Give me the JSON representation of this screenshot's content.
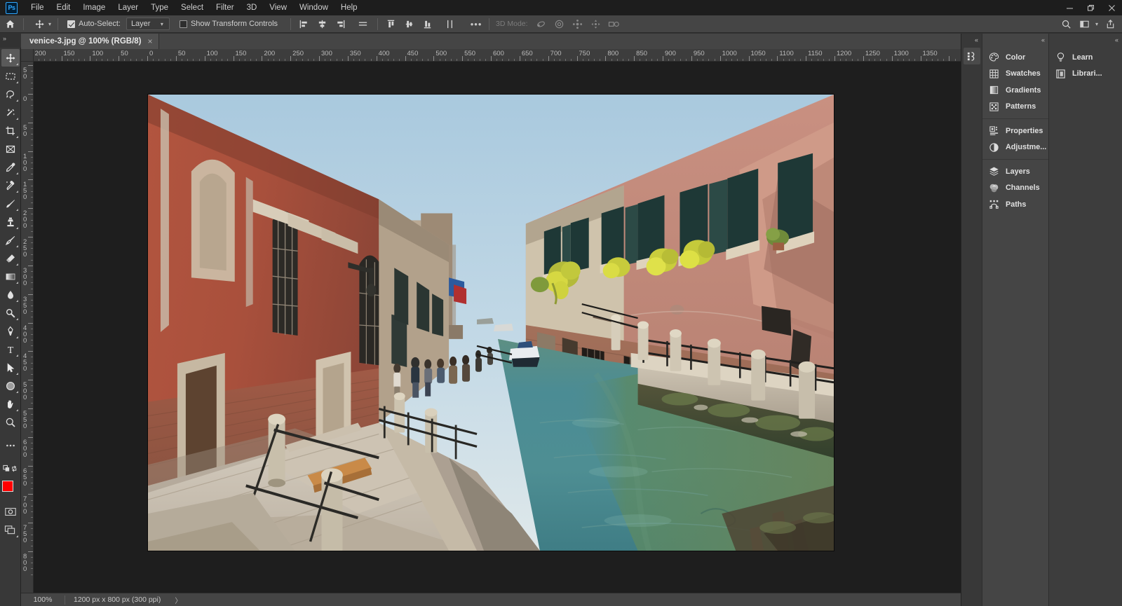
{
  "app": {
    "logo_text": "Ps",
    "title_menus": [
      "File",
      "Edit",
      "Image",
      "Layer",
      "Type",
      "Select",
      "Filter",
      "3D",
      "View",
      "Window",
      "Help"
    ],
    "window_controls": [
      {
        "name": "minimize",
        "glyph": "─"
      },
      {
        "name": "maximize",
        "glyph": "❐"
      },
      {
        "name": "close",
        "glyph": "✕"
      }
    ]
  },
  "options_bar": {
    "home_icon": "home-icon",
    "tool_icon": "move-tool-icon",
    "auto_select_label": "Auto-Select:",
    "auto_select_checked": true,
    "auto_select_scope": "Layer",
    "show_transform_label": "Show Transform Controls",
    "show_transform_checked": false,
    "align_group_1": [
      "align-left-edges",
      "align-horizontal-centers",
      "align-right-edges",
      "align-top-edges"
    ],
    "align_group_2": [
      "distribute-top-edges",
      "distribute-vertical-centers",
      "distribute-bottom-edges",
      "distribute-horizontal"
    ],
    "more_label": "•••",
    "mode_3d_label": "3D Mode:",
    "mode_3d_icons": [
      "rotate-3d-icon",
      "roll-3d-icon",
      "drag-3d-icon",
      "slide-3d-icon",
      "scale-3d-icon"
    ],
    "right_icons": [
      "search-icon",
      "workspace-icon",
      "chevron-down-icon",
      "share-icon"
    ]
  },
  "toolbar": {
    "collapse_glyph": "»",
    "tools": [
      {
        "name": "move-tool",
        "selected": true,
        "more": true
      },
      {
        "name": "rectangular-marquee-tool",
        "selected": false,
        "more": true
      },
      {
        "name": "lasso-tool",
        "selected": false,
        "more": true
      },
      {
        "name": "object-selection-tool",
        "selected": false,
        "more": true
      },
      {
        "name": "crop-tool",
        "selected": false,
        "more": true
      },
      {
        "name": "frame-tool",
        "selected": false,
        "more": false
      },
      {
        "name": "eyedropper-tool",
        "selected": false,
        "more": true
      },
      {
        "name": "spot-healing-brush-tool",
        "selected": false,
        "more": true
      },
      {
        "name": "brush-tool",
        "selected": false,
        "more": true
      },
      {
        "name": "clone-stamp-tool",
        "selected": false,
        "more": true
      },
      {
        "name": "history-brush-tool",
        "selected": false,
        "more": true
      },
      {
        "name": "eraser-tool",
        "selected": false,
        "more": true
      },
      {
        "name": "gradient-tool",
        "selected": false,
        "more": true
      },
      {
        "name": "blur-tool",
        "selected": false,
        "more": true
      },
      {
        "name": "dodge-tool",
        "selected": false,
        "more": true
      },
      {
        "name": "pen-tool",
        "selected": false,
        "more": true
      },
      {
        "name": "horizontal-type-tool",
        "selected": false,
        "more": true
      },
      {
        "name": "path-selection-tool",
        "selected": false,
        "more": true
      },
      {
        "name": "ellipse-tool",
        "selected": false,
        "more": true
      },
      {
        "name": "hand-tool",
        "selected": false,
        "more": true
      },
      {
        "name": "zoom-tool",
        "selected": false,
        "more": false
      },
      {
        "name": "edit-toolbar-tool",
        "selected": false,
        "more": false
      }
    ],
    "quick_mask_name": "quick-mask-mode-button",
    "screen_mode_name": "screen-mode-button",
    "foreground_color": "#ff0000",
    "background_color": "#000000"
  },
  "document": {
    "tab_title": "venice-3.jpg @ 100% (RGB/8)",
    "close_glyph": "×"
  },
  "rulers": {
    "horizontal_labels": [
      "200",
      "150",
      "100",
      "50",
      "0",
      "50",
      "100",
      "150",
      "200",
      "250",
      "300",
      "350",
      "400",
      "450",
      "500",
      "550",
      "600",
      "650",
      "700",
      "750",
      "800",
      "850",
      "900",
      "950",
      "1000",
      "1050",
      "1100",
      "1150",
      "1200",
      "1250",
      "1300",
      "1350"
    ],
    "vertical_labels": [
      "50",
      "0",
      "50",
      "100",
      "150",
      "200",
      "250",
      "300",
      "350",
      "400",
      "450",
      "500",
      "550",
      "600",
      "650",
      "700",
      "750",
      "800"
    ],
    "units": "px"
  },
  "panels": {
    "collapse_glyph": "«",
    "dock_a_icon": "properties-dock-icon",
    "dock_b_groups": [
      [
        {
          "label": "Color",
          "icon": "color-palette-icon"
        },
        {
          "label": "Swatches",
          "icon": "swatches-grid-icon"
        },
        {
          "label": "Gradients",
          "icon": "gradients-icon"
        },
        {
          "label": "Patterns",
          "icon": "patterns-icon"
        }
      ],
      [
        {
          "label": "Properties",
          "icon": "properties-icon"
        },
        {
          "label": "Adjustme...",
          "icon": "adjustments-icon"
        }
      ],
      [
        {
          "label": "Layers",
          "icon": "layers-icon"
        },
        {
          "label": "Channels",
          "icon": "channels-icon"
        },
        {
          "label": "Paths",
          "icon": "paths-icon"
        }
      ]
    ],
    "dock_c_items": [
      {
        "label": "Learn",
        "icon": "lightbulb-icon"
      },
      {
        "label": "Librari...",
        "icon": "libraries-icon"
      }
    ]
  },
  "status_bar": {
    "zoom": "100%",
    "doc_info": "1200 px x 800 px (300 ppi)",
    "expand_glyph": "〉"
  },
  "photo": {
    "alt": "Venice canal with red-ochre buildings, stone walkway, bollards and green water",
    "colors": {
      "sky": "#bcd6e6",
      "water_teal": "#4e8c96",
      "water_green": "#5e7f57",
      "left_wall_red": "#a8503f",
      "right_wall_pink": "#c08576",
      "brick": "#9a6a55",
      "stone_walk": "#c9bfb0",
      "shutters": "#1f3a3a",
      "flowers_yellow": "#d7d43a"
    }
  }
}
